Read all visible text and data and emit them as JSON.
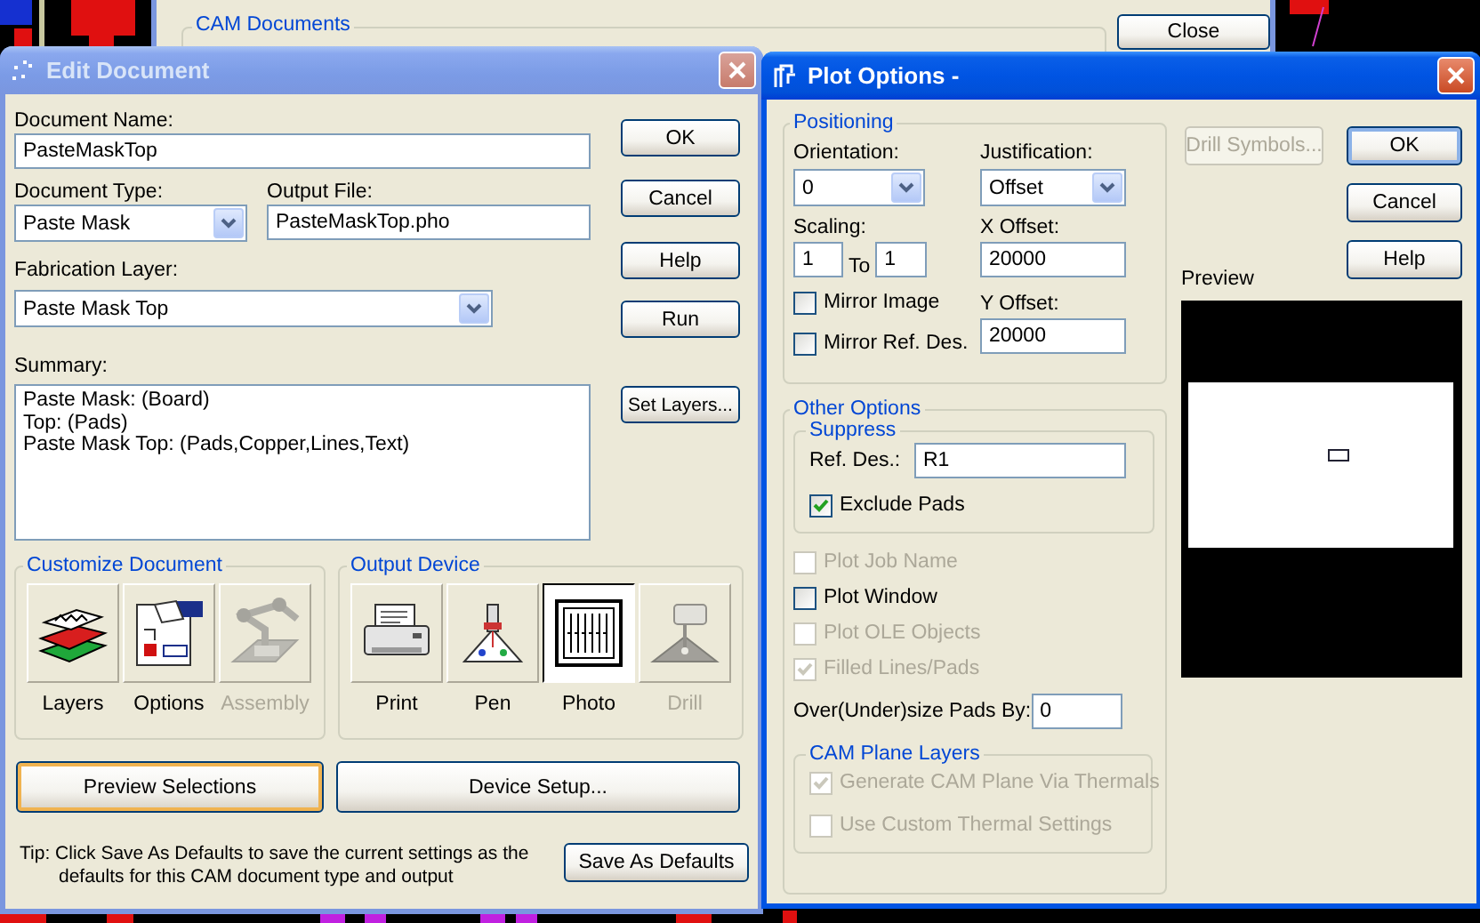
{
  "background_window": {
    "group_label": "CAM Documents",
    "close_button": "Close"
  },
  "edit_document": {
    "title": "Edit Document",
    "active": false,
    "document_name": {
      "label": "Document Name:",
      "value": "PasteMaskTop"
    },
    "document_type": {
      "label": "Document Type:",
      "value": "Paste Mask"
    },
    "output_file": {
      "label": "Output File:",
      "value": "PasteMaskTop.pho"
    },
    "fabrication_layer": {
      "label": "Fabrication Layer:",
      "value": "Paste Mask Top"
    },
    "summary": {
      "label": "Summary:",
      "lines": [
        "Paste Mask: (Board)",
        "Top: (Pads)",
        "Paste Mask Top: (Pads,Copper,Lines,Text)"
      ]
    },
    "side_buttons": [
      {
        "label": "OK"
      },
      {
        "label": "Cancel"
      },
      {
        "label": "Help"
      },
      {
        "label": "Run"
      },
      {
        "label": "Set Layers..."
      }
    ],
    "customize_document": {
      "title": "Customize Document",
      "items": [
        {
          "kind": "layers",
          "label": "Layers",
          "disabled": false,
          "selected": false
        },
        {
          "kind": "options",
          "label": "Options",
          "disabled": false,
          "selected": false
        },
        {
          "kind": "assembly",
          "label": "Assembly",
          "disabled": true,
          "selected": false
        }
      ]
    },
    "output_device": {
      "title": "Output Device",
      "items": [
        {
          "kind": "print",
          "label": "Print",
          "disabled": false,
          "selected": false
        },
        {
          "kind": "pen",
          "label": "Pen",
          "disabled": false,
          "selected": false
        },
        {
          "kind": "photo",
          "label": "Photo",
          "disabled": false,
          "selected": true
        },
        {
          "kind": "drill",
          "label": "Drill",
          "disabled": true,
          "selected": false
        }
      ]
    },
    "bottom_buttons": [
      {
        "label": "Preview Selections",
        "focused": true
      },
      {
        "label": "Device Setup...",
        "focused": false
      }
    ],
    "tip": "Tip: Click Save As Defaults to save the current settings as the defaults for this CAM document type and output",
    "save_defaults_button": "Save As Defaults"
  },
  "plot_options": {
    "title": "Plot Options -",
    "active": true,
    "positioning": {
      "title": "Positioning",
      "orientation": {
        "label": "Orientation:",
        "value": "0"
      },
      "justification": {
        "label": "Justification:",
        "value": "Offset"
      },
      "scaling": {
        "label": "Scaling:",
        "from": "1",
        "to_label": "To",
        "to": "1"
      },
      "x_offset": {
        "label": "X Offset:",
        "value": "20000"
      },
      "y_offset": {
        "label": "Y Offset:",
        "value": "20000"
      },
      "checkboxes": [
        {
          "label": "Mirror Image",
          "checked": false,
          "disabled": false
        },
        {
          "label": "Mirror Ref. Des.",
          "checked": false,
          "disabled": false
        }
      ]
    },
    "other_options": {
      "title": "Other Options",
      "suppress": {
        "title": "Suppress",
        "ref_des": {
          "label": "Ref. Des.:",
          "value": "R1"
        },
        "exclude_pads": {
          "label": "Exclude Pads",
          "checked": true,
          "disabled": false
        }
      },
      "checkboxes": [
        {
          "label": "Plot Job Name",
          "checked": false,
          "disabled": true
        },
        {
          "label": "Plot Window",
          "checked": false,
          "disabled": false
        },
        {
          "label": "Plot OLE Objects",
          "checked": false,
          "disabled": true
        },
        {
          "label": "Filled Lines/Pads",
          "checked": true,
          "disabled": true
        }
      ],
      "oversize": {
        "label": "Over(Under)size Pads By:",
        "value": "0"
      },
      "cam_plane_layers": {
        "title": "CAM Plane Layers",
        "checkboxes": [
          {
            "label": "Generate CAM Plane Via Thermals",
            "checked": true,
            "disabled": true
          },
          {
            "label": "Use Custom Thermal Settings",
            "checked": false,
            "disabled": true
          }
        ]
      }
    },
    "buttons": [
      {
        "label": "Drill Symbols...",
        "disabled": true,
        "focused": false
      },
      {
        "label": "OK",
        "disabled": false,
        "focused": true
      },
      {
        "label": "Cancel",
        "disabled": false,
        "focused": false
      },
      {
        "label": "Help",
        "disabled": false,
        "focused": false
      }
    ],
    "preview": {
      "label": "Preview"
    }
  }
}
